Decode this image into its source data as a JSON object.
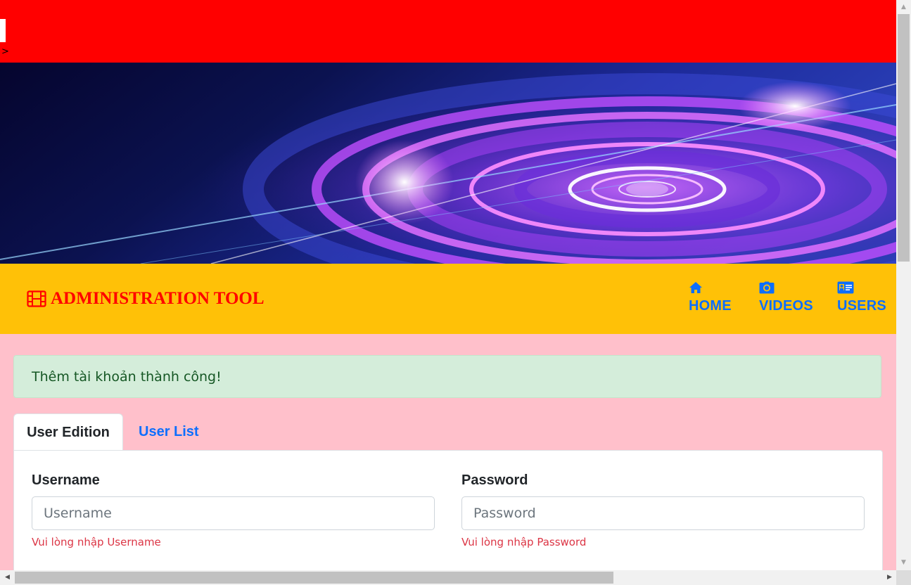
{
  "top_strip": {
    "marker": ">"
  },
  "brand": {
    "title": "ADMINISTRATION TOOL",
    "icon": "film-icon",
    "color": "#ff0000"
  },
  "nav": {
    "items": [
      {
        "label": "HOME",
        "icon": "home-icon"
      },
      {
        "label": "VIDEOS",
        "icon": "camera-icon"
      },
      {
        "label": "USERS",
        "icon": "id-card-icon"
      }
    ],
    "color": "#0d6efd",
    "background": "#ffc107"
  },
  "alert": {
    "message": "Thêm tài khoản thành công!",
    "type": "success"
  },
  "tabs": [
    {
      "label": "User Edition",
      "active": true
    },
    {
      "label": "User List",
      "active": false
    }
  ],
  "form": {
    "username": {
      "label": "Username",
      "placeholder": "Username",
      "value": "",
      "error": "Vui lòng nhập Username"
    },
    "password": {
      "label": "Password",
      "placeholder": "Password",
      "value": "",
      "error": "Vui lòng nhập Password"
    }
  },
  "colors": {
    "page_bg": "#ffc0cb",
    "top_strip": "#ff0000",
    "error": "#dc3545",
    "alert_bg": "#d4edda"
  }
}
